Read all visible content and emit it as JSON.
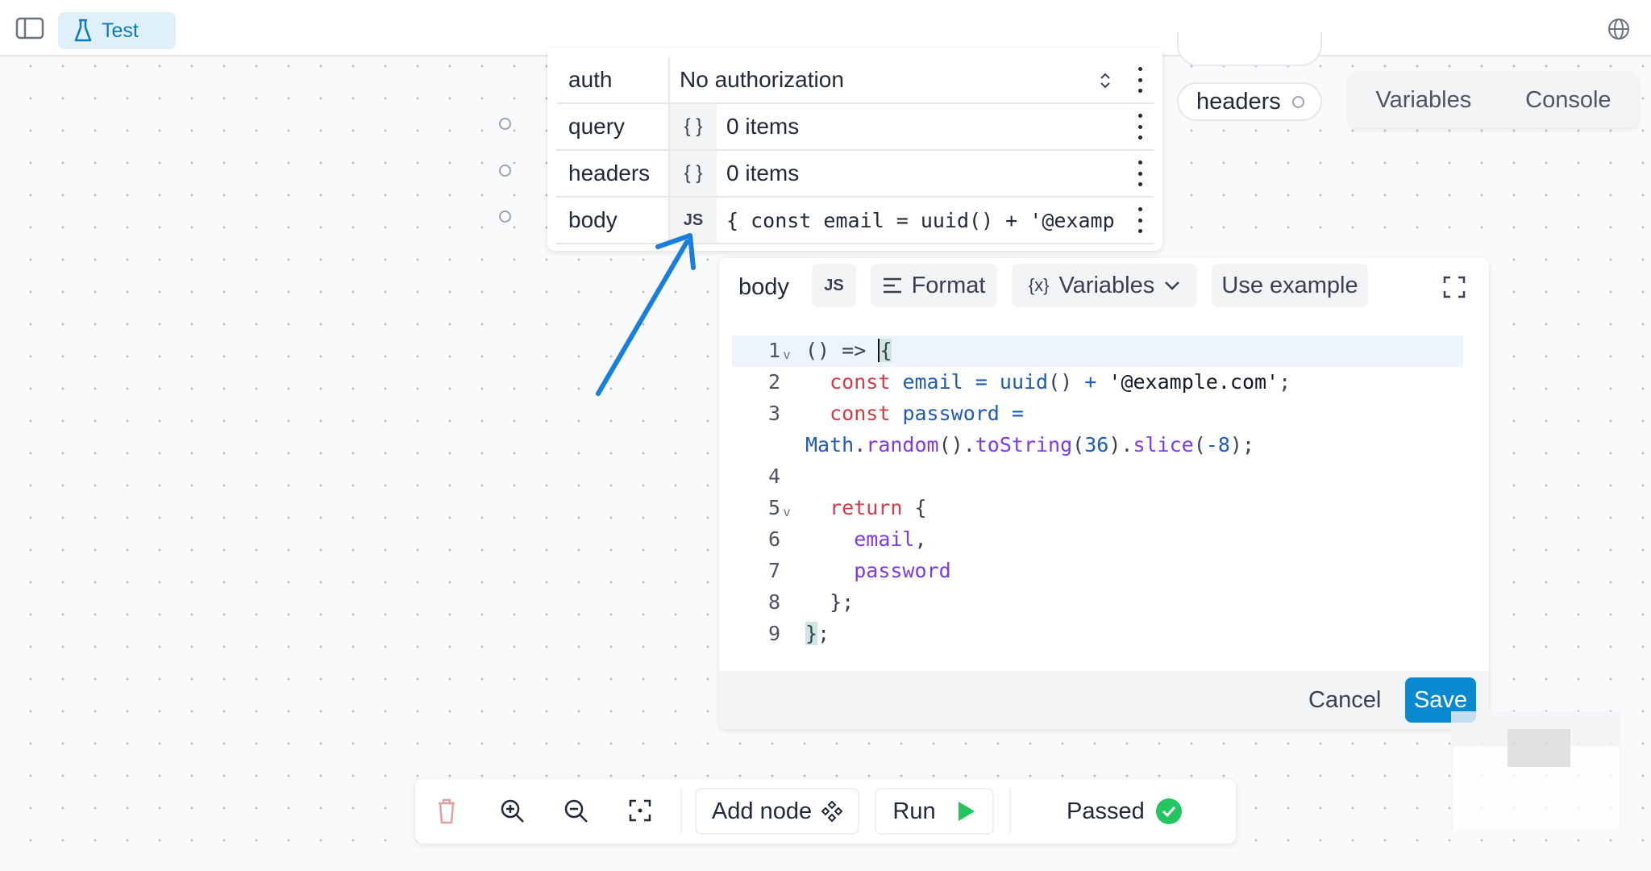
{
  "topbar": {
    "tab_label": "Test",
    "tab_icon": "flask-icon",
    "left_icon": "sidebar-toggle-icon",
    "right_icon": "globe-icon"
  },
  "node": {
    "rows": [
      {
        "label": "auth",
        "value": "No authorization"
      },
      {
        "label": "query",
        "type": "{ }",
        "value": "0 items"
      },
      {
        "label": "headers",
        "type": "{ }",
        "value": "0 items"
      },
      {
        "label": "body",
        "type": "JS",
        "value": "{ const email = uuid() + '@examp"
      }
    ]
  },
  "right": {
    "pill_headers": "headers",
    "tabs": [
      "Variables",
      "Console"
    ]
  },
  "editor": {
    "label": "body",
    "lang": "JS",
    "format": "Format",
    "variables": "Variables",
    "variables_icon": "{x}",
    "use_example": "Use example",
    "cancel": "Cancel",
    "save": "Save",
    "accent": "#0a88d0",
    "line_numbers": [
      "1",
      "2",
      "3",
      "",
      "4",
      "5",
      "6",
      "7",
      "8",
      "9"
    ]
  },
  "toolbar": {
    "add_node": "Add node",
    "run": "Run",
    "status": "Passed",
    "status_color": "#22c55e"
  }
}
